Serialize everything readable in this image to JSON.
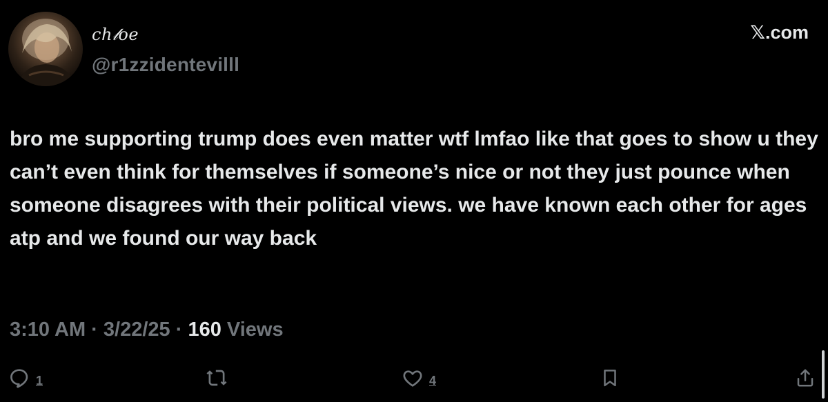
{
  "author": {
    "display_name": "cℎ𝓁oe",
    "handle": "@r1zzidentevilll"
  },
  "brand": "𝕏.com",
  "tweet": {
    "text": "bro me supporting trump does even matter wtf lmfao like that goes to show u they can’t even think for themselves if someone’s nice or not they just pounce when someone disagrees with their political views. we have known each other for ages atp and we found our way back",
    "time": "3:10 AM",
    "separator": " · ",
    "date": "3/22/25",
    "views_count": "160",
    "views_label": " Views"
  },
  "actions": {
    "reply_count": "1",
    "like_count": "4"
  },
  "icons": {
    "reply": "reply-icon",
    "retweet": "retweet-icon",
    "like": "heart-icon",
    "bookmark": "bookmark-icon",
    "share": "share-icon"
  },
  "colors": {
    "background": "#000000",
    "primary_text": "#e7e9ea",
    "secondary_text": "#71767b"
  }
}
